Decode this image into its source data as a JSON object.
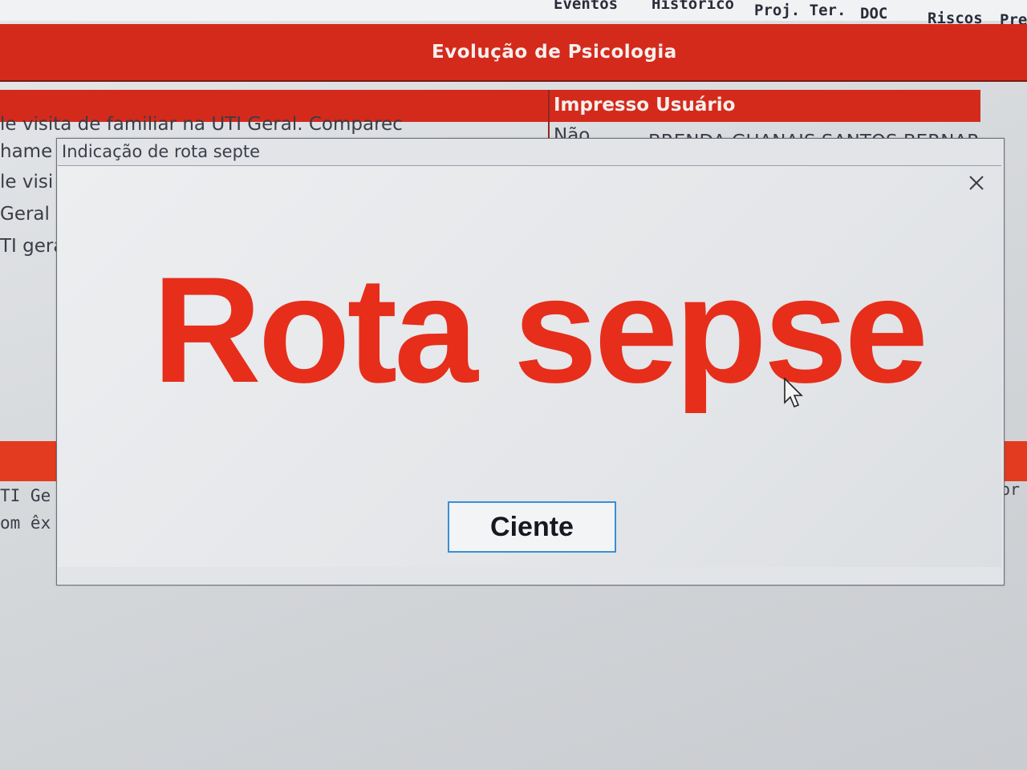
{
  "top_menu": {
    "items": [
      "Eventos",
      "Histórico",
      "Proj. Ter.",
      "DOC",
      "Riscos",
      "Pre"
    ]
  },
  "page": {
    "title": "Evolução de Psicologia",
    "table_header": "Impresso Usuário",
    "row_fragments": [
      "le visita de familiar na UTI Geral. Comparec",
      "hame",
      "le visi",
      "Geral p",
      "TI gera"
    ],
    "row_impresso": "Não",
    "row_usuario": "BRENDA GUANAIS SANTOS BERNAR",
    "lower_fragments": [
      "TI Ge",
      "om êx"
    ],
    "right_fragment": "or"
  },
  "backdrop_window": {
    "title": "Indicação de rota septe"
  },
  "dialog": {
    "message": "Rota sepse",
    "button_label": "Ciente",
    "close_icon": "close-icon"
  },
  "colors": {
    "brand_red": "#d42a1c",
    "alert_red": "#e62e1b",
    "button_focus": "#3a8fd6"
  }
}
